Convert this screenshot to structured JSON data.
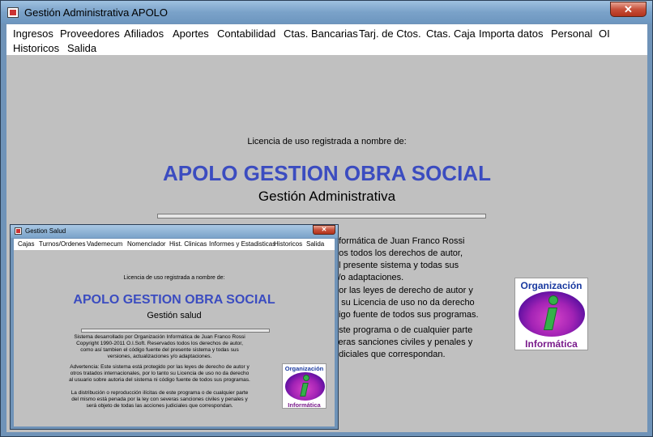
{
  "window": {
    "title": "Gestión Administrativa APOLO",
    "close_glyph": "✕",
    "icon": "app-window-icon"
  },
  "menu": {
    "items": [
      "Ingresos",
      "Proveedores",
      "Afiliados",
      "Aportes",
      "Contabilidad",
      "Ctas. Bancarias",
      "Tarj. de Ctos.",
      "Ctas. Caja",
      "Importa datos",
      "Personal",
      "OI",
      "Historicos",
      "Salida"
    ]
  },
  "main": {
    "license_label": "Licencia de uso registrada a nombre de:",
    "app_title": "APOLO GESTION OBRA SOCIAL",
    "subtitle": "Gestión Administrativa",
    "para1": [
      "nformática de Juan Franco Rossi",
      "dos todos los derechos de autor,",
      "el presente sistema y todas sus",
      "y/o adaptaciones."
    ],
    "para2": [
      "por las leyes de derecho de autor y",
      "o su Licencia de uso no da derecho",
      "digo fuente de todos sus programas."
    ],
    "para3": [
      "este programa o de cualquier parte",
      "veras sanciones civiles y penales y",
      "udiciales que correspondan."
    ],
    "logo": {
      "top": "Organización",
      "bottom": "Informática"
    }
  },
  "child": {
    "title": "Gestion Salud",
    "close_glyph": "✕",
    "menu": [
      "Cajas",
      "Turnos/Ordenes",
      "Vademecum",
      "Nomenclador",
      "Hist. Clinicas",
      "Informes y Estadisticas",
      "Historicos",
      "Salida"
    ],
    "license_label": "Licencia de uso registrada a nombre de:",
    "app_title": "APOLO GESTION OBRA SOCIAL",
    "subtitle": "Gestión salud",
    "para1": [
      "Sistema desarrollado por Organización Informática de Juan Franco Rossi",
      "Copyright 1990-2011 O.I.Soft. Reservados todos los derechos de autor,",
      "como así tambien el código fuente del presente sistema y todas sus",
      "versiones, actualizaciones y/o adaptaciones."
    ],
    "para2": [
      "Advertencia: Este sistema está protegido por las leyes de derecho de autor y",
      "otros tratados internacionales, por lo tanto su Licencia de uso no da derecho",
      "al usuario sobre autoria del sistema ni código fuente de todos sus programas."
    ],
    "para3": [
      "La distribución o reproducción ilícitas de este programa o de cualquier parte",
      "del mismo está penada por la ley con severas sanciones civiles y penales y",
      "será objeto de todas las acciones judiciales que correspondan."
    ],
    "logo": {
      "top": "Organización",
      "bottom": "Informática"
    }
  },
  "colors": {
    "title_blue": "#3b4cc0",
    "client_gray": "#c0c0c0",
    "logo_magenta": "#a323b5"
  }
}
